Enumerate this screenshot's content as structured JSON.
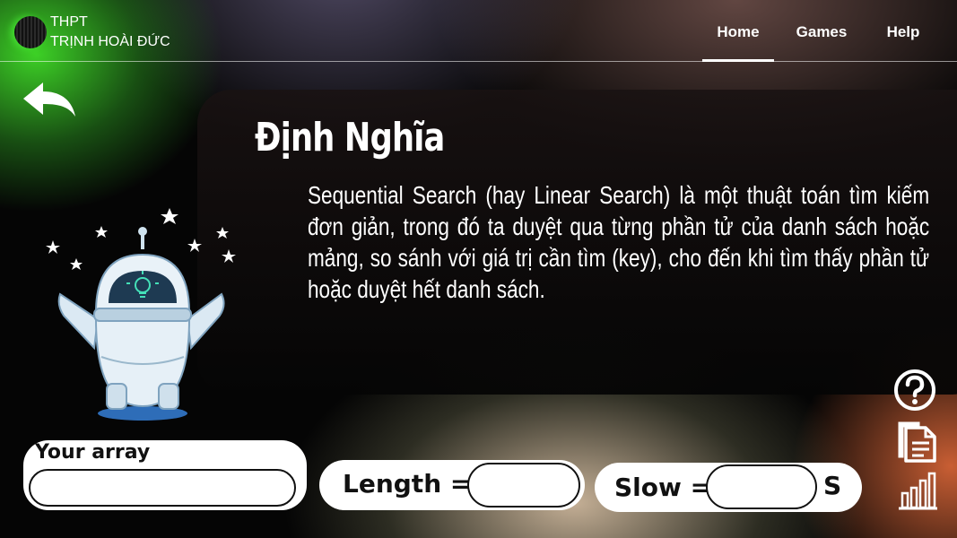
{
  "brand": {
    "line1": "THPT",
    "line2": "TRỊNH HOÀI ĐỨC"
  },
  "nav": {
    "home": "Home",
    "games": "Games",
    "help": "Help"
  },
  "definition": {
    "title": "Định Nghĩa",
    "body": "Sequential Search (hay Linear Search) là một thuật toán tìm kiếm đơn giản, trong đó ta duyệt qua từng phần tử của danh sách hoặc mảng, so sánh với giá trị cần tìm (key), cho đến khi tìm thấy phần tử hoặc duyệt hết danh sách."
  },
  "inputs": {
    "array_label": "Your array",
    "array_value": "",
    "length_label": "Length =",
    "length_value": "",
    "slow_label": "Slow =",
    "slow_value": "",
    "slow_unit": "S"
  },
  "icons": {
    "back": "back-arrow-icon",
    "help": "question-circle-icon",
    "document": "document-icon",
    "chart": "bar-chart-icon",
    "robot": "robot-lightbulb-icon"
  },
  "colors": {
    "accent_green": "#40dc28",
    "panel": "#120c0c",
    "robot_screen": "#1e3a52"
  }
}
